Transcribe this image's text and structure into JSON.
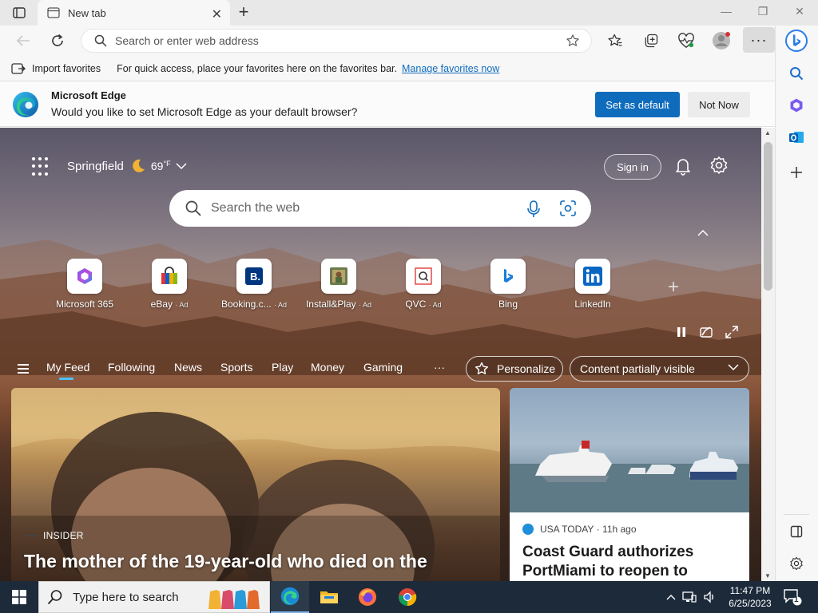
{
  "browser": {
    "tab": {
      "title": "New tab"
    },
    "address": {
      "placeholder": "Search or enter web address"
    }
  },
  "favorites_bar": {
    "import_label": "Import favorites",
    "message": "For quick access, place your favorites here on the favorites bar.",
    "manage_link": "Manage favorites now"
  },
  "infobar": {
    "title": "Microsoft Edge",
    "message": "Would you like to set Microsoft Edge as your default browser?",
    "primary_button": "Set as default",
    "secondary_button": "Not Now",
    "primary_color": "#0f6cbd"
  },
  "newtab": {
    "location": "Springfield",
    "temperature": "69",
    "temp_unit": "°F",
    "signin_label": "Sign in",
    "search_placeholder": "Search the web",
    "quick_links": [
      {
        "label": "Microsoft 365",
        "ad": ""
      },
      {
        "label": "eBay",
        "ad": "· Ad"
      },
      {
        "label": "Booking.c...",
        "ad": "· Ad"
      },
      {
        "label": "Install&Play",
        "ad": "· Ad"
      },
      {
        "label": "QVC",
        "ad": "· Ad"
      },
      {
        "label": "Bing",
        "ad": ""
      },
      {
        "label": "LinkedIn",
        "ad": ""
      }
    ],
    "feed_nav": [
      "My Feed",
      "Following",
      "News",
      "Sports",
      "Play",
      "Money",
      "Gaming"
    ],
    "more_label": "···",
    "personalize_label": "Personalize",
    "content_visibility": "Content partially visible"
  },
  "feed": {
    "main_card": {
      "source": "INSIDER",
      "headline": "The mother of the 19-year-old who died on the"
    },
    "side_card": {
      "source": "USA TODAY",
      "age": "· 11h ago",
      "headline": "Coast Guard authorizes PortMiami to reopen to"
    }
  },
  "taskbar": {
    "search_placeholder": "Type here to search",
    "time": "11:47 PM",
    "date": "6/25/2023",
    "notification_count": "1"
  }
}
